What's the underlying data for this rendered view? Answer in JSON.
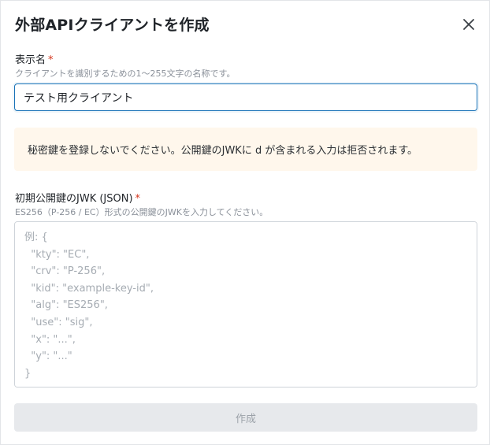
{
  "dialog": {
    "title": "外部APIクライアントを作成",
    "close_icon": "close-icon"
  },
  "display_name": {
    "label": "表示名",
    "required_mark": "*",
    "hint": "クライアントを識別するための1〜255文字の名称です。",
    "value": "テスト用クライアント"
  },
  "warning": {
    "text": "秘密鍵を登録しないでください。公開鍵のJWKに d が含まれる入力は拒否されます。"
  },
  "jwk": {
    "label": "初期公開鍵のJWK (JSON)",
    "required_mark": "*",
    "hint": "ES256（P-256 / EC）形式の公開鍵のJWKを入力してください。",
    "value": "",
    "placeholder": "例: {\n  \"kty\": \"EC\",\n  \"crv\": \"P-256\",\n  \"kid\": \"example-key-id\",\n  \"alg\": \"ES256\",\n  \"use\": \"sig\",\n  \"x\": \"...\",\n  \"y\": \"...\"\n}"
  },
  "actions": {
    "submit_label": "作成",
    "submit_disabled": true
  }
}
